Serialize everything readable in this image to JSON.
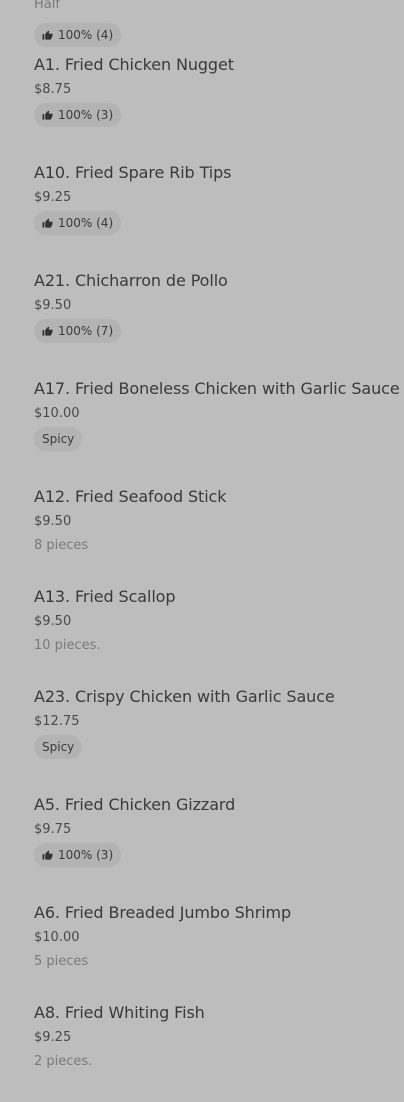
{
  "top_partial": {
    "description": "Half",
    "rating": "100% (4)"
  },
  "items": [
    {
      "name": "A1. Fried Chicken Nugget",
      "price": "$8.75",
      "rating": "100% (3)"
    },
    {
      "name": "A10. Fried Spare Rib Tips",
      "price": "$9.25",
      "rating": "100% (4)"
    },
    {
      "name": "A21. Chicharron de Pollo",
      "price": "$9.50",
      "rating": "100% (7)"
    },
    {
      "name": "A17. Fried Boneless Chicken with Garlic Sauce",
      "price": "$10.00",
      "tag": "Spicy"
    },
    {
      "name": "A12. Fried Seafood Stick",
      "price": "$9.50",
      "description": "8 pieces"
    },
    {
      "name": "A13. Fried Scallop",
      "price": "$9.50",
      "description": "10 pieces."
    },
    {
      "name": "A23. Crispy Chicken with Garlic Sauce",
      "price": "$12.75",
      "tag": "Spicy"
    },
    {
      "name": "A5. Fried Chicken Gizzard",
      "price": "$9.75",
      "rating": "100% (3)"
    },
    {
      "name": "A6. Fried Breaded Jumbo Shrimp",
      "price": "$10.00",
      "description": "5 pieces"
    },
    {
      "name": "A8. Fried Whiting Fish",
      "price": "$9.25",
      "description": "2 pieces."
    }
  ],
  "icons": {
    "rating_icon": "thumbs-up-icon"
  },
  "colors": {
    "background": "#bdbdbd",
    "badge_background": "#b3b3b3",
    "title_text": "#3a3a3a",
    "secondary_text": "#7a7a7a"
  }
}
